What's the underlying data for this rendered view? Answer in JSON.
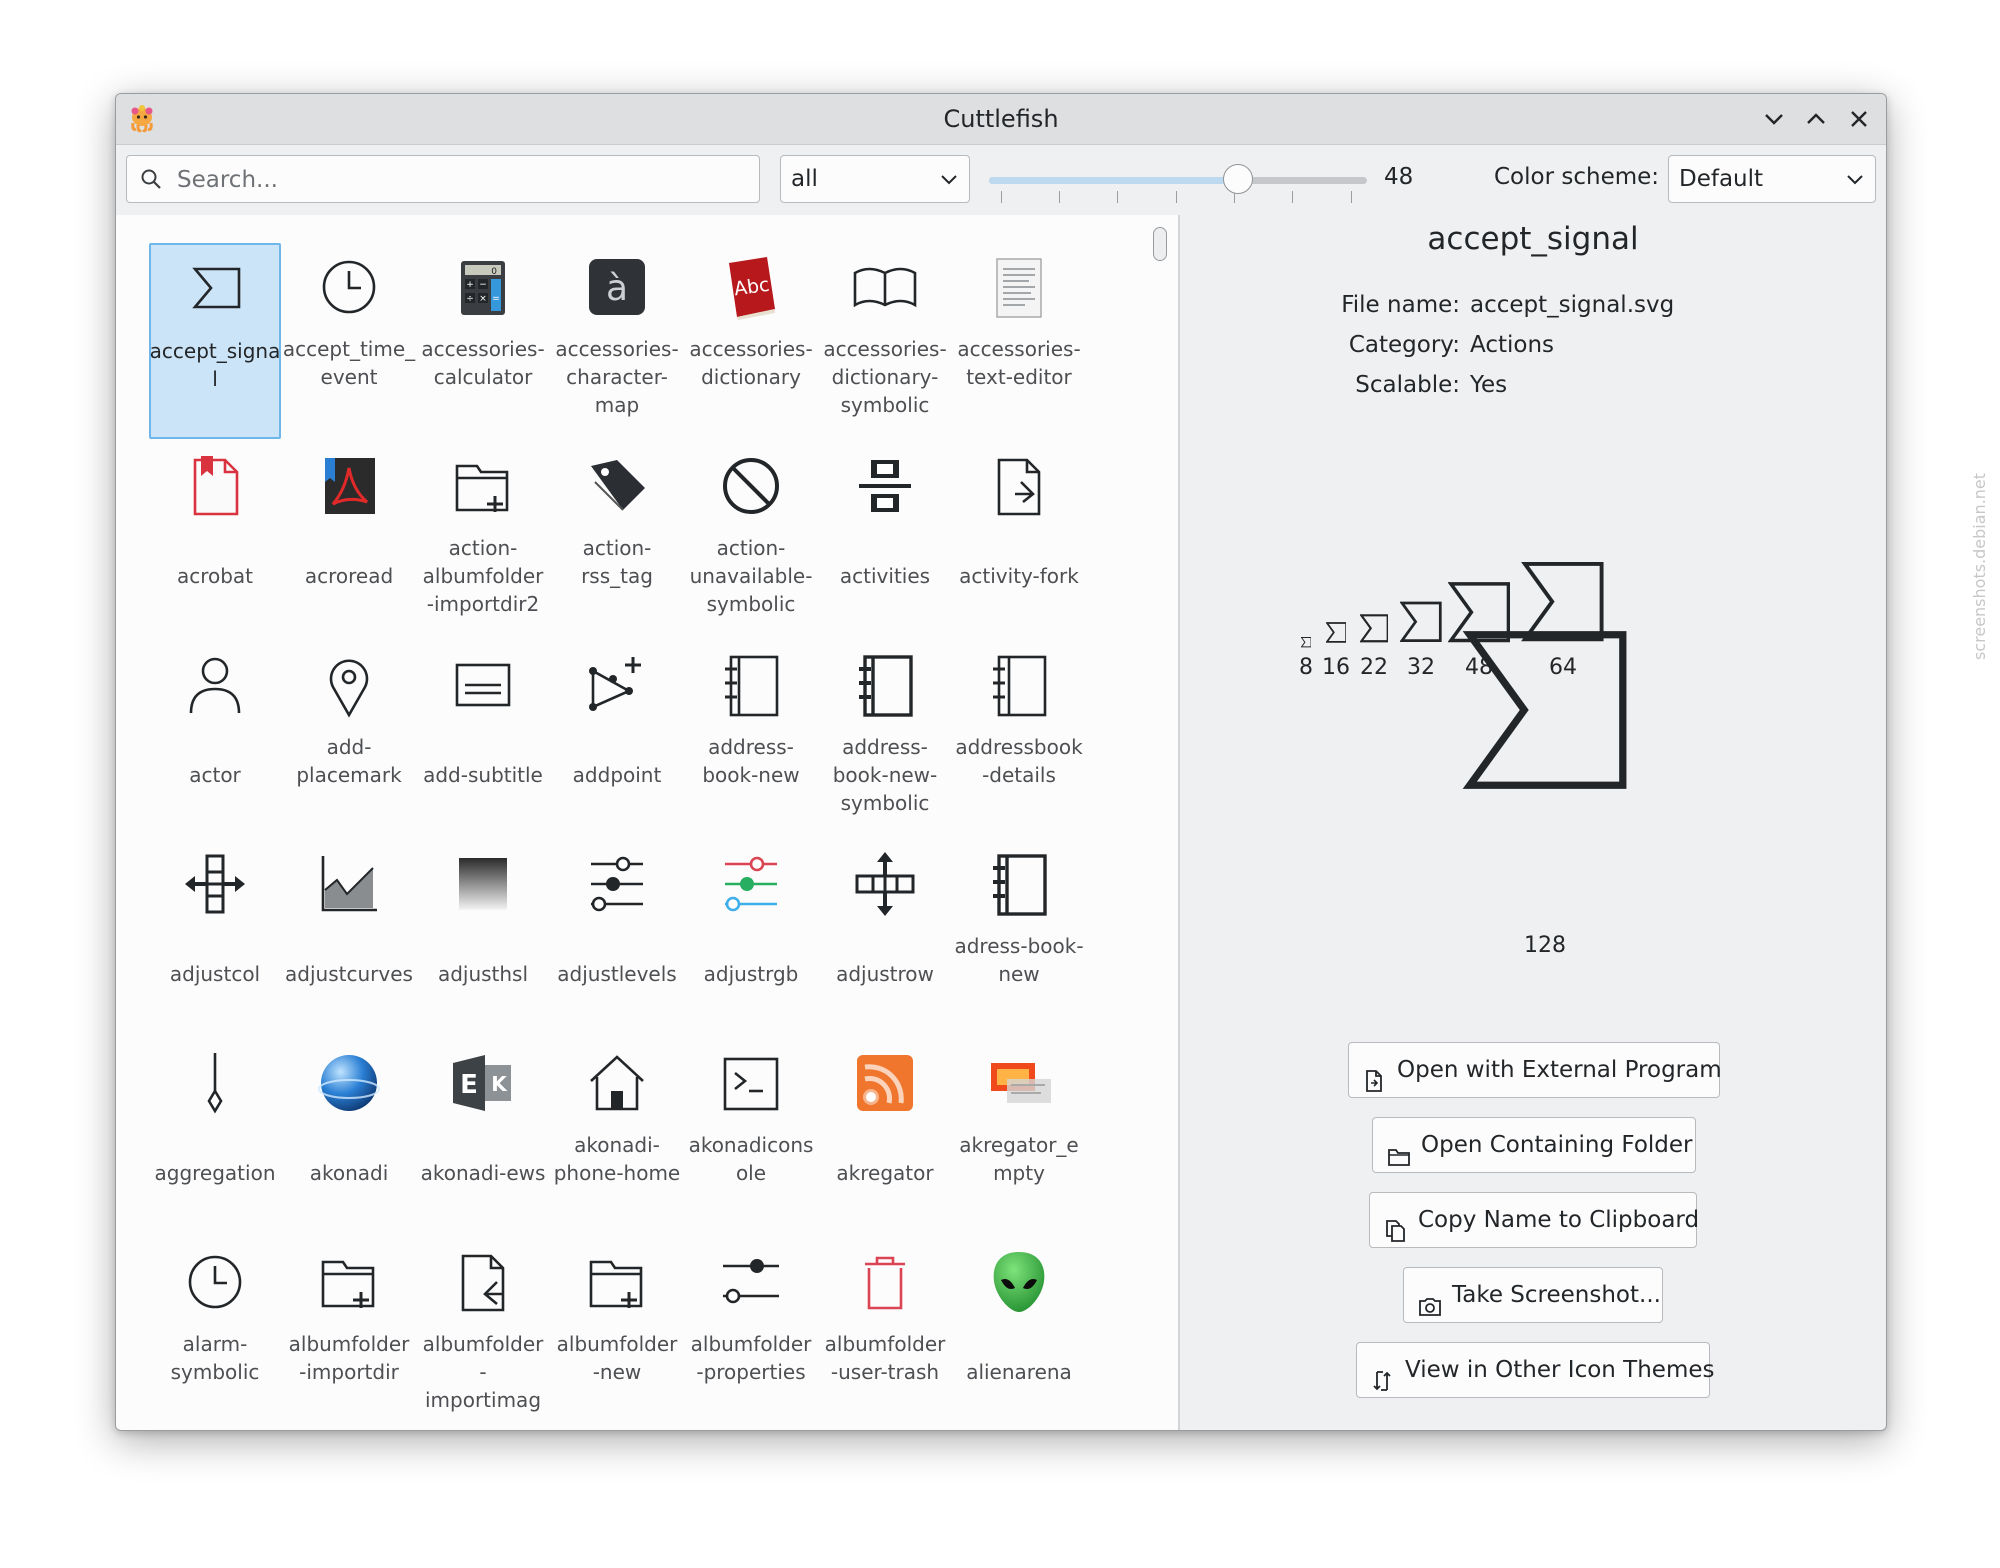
{
  "window": {
    "title": "Cuttlefish"
  },
  "toolbar": {
    "search_placeholder": "Search...",
    "category_value": "all",
    "size_value": 48,
    "size_fraction": 0.66,
    "color_scheme_label": "Color scheme:",
    "color_scheme_value": "Default"
  },
  "icons": [
    {
      "label": "accept_signa\nl",
      "icon": "sigma-icon",
      "selected": true
    },
    {
      "label": "accept_time_\nevent",
      "icon": "clock-icon"
    },
    {
      "label": "accessories-\ncalculator",
      "icon": "calculator-icon"
    },
    {
      "label": "accessories-\ncharacter-\nmap",
      "icon": "character-map-icon"
    },
    {
      "label": "accessories-\ndictionary",
      "icon": "dictionary-book-icon"
    },
    {
      "label": "accessories-\ndictionary-\nsymbolic",
      "icon": "open-book-icon"
    },
    {
      "label": "accessories-\ntext-editor",
      "icon": "text-editor-icon"
    },
    {
      "label": "acrobat",
      "icon": "acrobat-document-icon"
    },
    {
      "label": "acroread",
      "icon": "acroread-icon"
    },
    {
      "label": "action-\nalbumfolder\n-importdir2",
      "icon": "folder-add-icon"
    },
    {
      "label": "action-\nrss_tag",
      "icon": "tag-icon"
    },
    {
      "label": "action-\nunavailable-\nsymbolic",
      "icon": "prohibited-icon"
    },
    {
      "label": "activities",
      "icon": "activities-icon"
    },
    {
      "label": "activity-fork",
      "icon": "document-fork-icon"
    },
    {
      "label": "actor",
      "icon": "person-icon"
    },
    {
      "label": "add-\nplacemark",
      "icon": "map-pin-icon"
    },
    {
      "label": "add-subtitle",
      "icon": "subtitle-icon"
    },
    {
      "label": "addpoint",
      "icon": "addpoint-icon"
    },
    {
      "label": "address-\nbook-new",
      "icon": "address-book-icon"
    },
    {
      "label": "address-\nbook-new-\nsymbolic",
      "icon": "address-book-bold-icon"
    },
    {
      "label": "addressbook\n-details",
      "icon": "address-book-details-icon"
    },
    {
      "label": "adjustcol",
      "icon": "adjust-column-icon"
    },
    {
      "label": "adjustcurves",
      "icon": "curves-chart-icon"
    },
    {
      "label": "adjusthsl",
      "icon": "gradient-square-icon"
    },
    {
      "label": "adjustlevels",
      "icon": "sliders-icon"
    },
    {
      "label": "adjustrgb",
      "icon": "rgb-sliders-icon"
    },
    {
      "label": "adjustrow",
      "icon": "adjust-row-icon"
    },
    {
      "label": "adress-book-\nnew",
      "icon": "address-book-bold-icon"
    },
    {
      "label": "aggregation",
      "icon": "aggregation-diamond-icon"
    },
    {
      "label": "akonadi",
      "icon": "akonadi-sphere-icon"
    },
    {
      "label": "akonadi-ews",
      "icon": "exchange-icon"
    },
    {
      "label": "akonadi-\nphone-home",
      "icon": "home-icon"
    },
    {
      "label": "akonadicons\nole",
      "icon": "terminal-icon"
    },
    {
      "label": "akregator",
      "icon": "rss-feed-icon"
    },
    {
      "label": "akregator_e\nmpty",
      "icon": "akregator-empty-icon"
    },
    {
      "label": "alarm-\nsymbolic",
      "icon": "clock-icon"
    },
    {
      "label": "albumfolder\n-importdir",
      "icon": "folder-add-icon"
    },
    {
      "label": "albumfolder\n-\nimportimag",
      "icon": "document-import-icon"
    },
    {
      "label": "albumfolder\n-new",
      "icon": "folder-add-icon"
    },
    {
      "label": "albumfolder\n-properties",
      "icon": "properties-sliders-icon"
    },
    {
      "label": "albumfolder\n-user-trash",
      "icon": "trash-icon"
    },
    {
      "label": "alienarena",
      "icon": "alien-head-icon"
    }
  ],
  "details": {
    "name": "accept_signal",
    "file_name_label": "File name:",
    "file_name": "accept_signal.svg",
    "category_label": "Category:",
    "category": "Actions",
    "scalable_label": "Scalable:",
    "scalable": "Yes",
    "sizes": [
      "8",
      "16",
      "22",
      "32",
      "48",
      "64"
    ],
    "large_size": "128",
    "buttons": {
      "open_external": "Open with External Program",
      "open_folder": "Open Containing Folder",
      "copy_name": "Copy Name to Clipboard",
      "screenshot": "Take Screenshot...",
      "other_themes": "View in Other Icon Themes"
    }
  },
  "watermark": "screenshots.debian.net"
}
